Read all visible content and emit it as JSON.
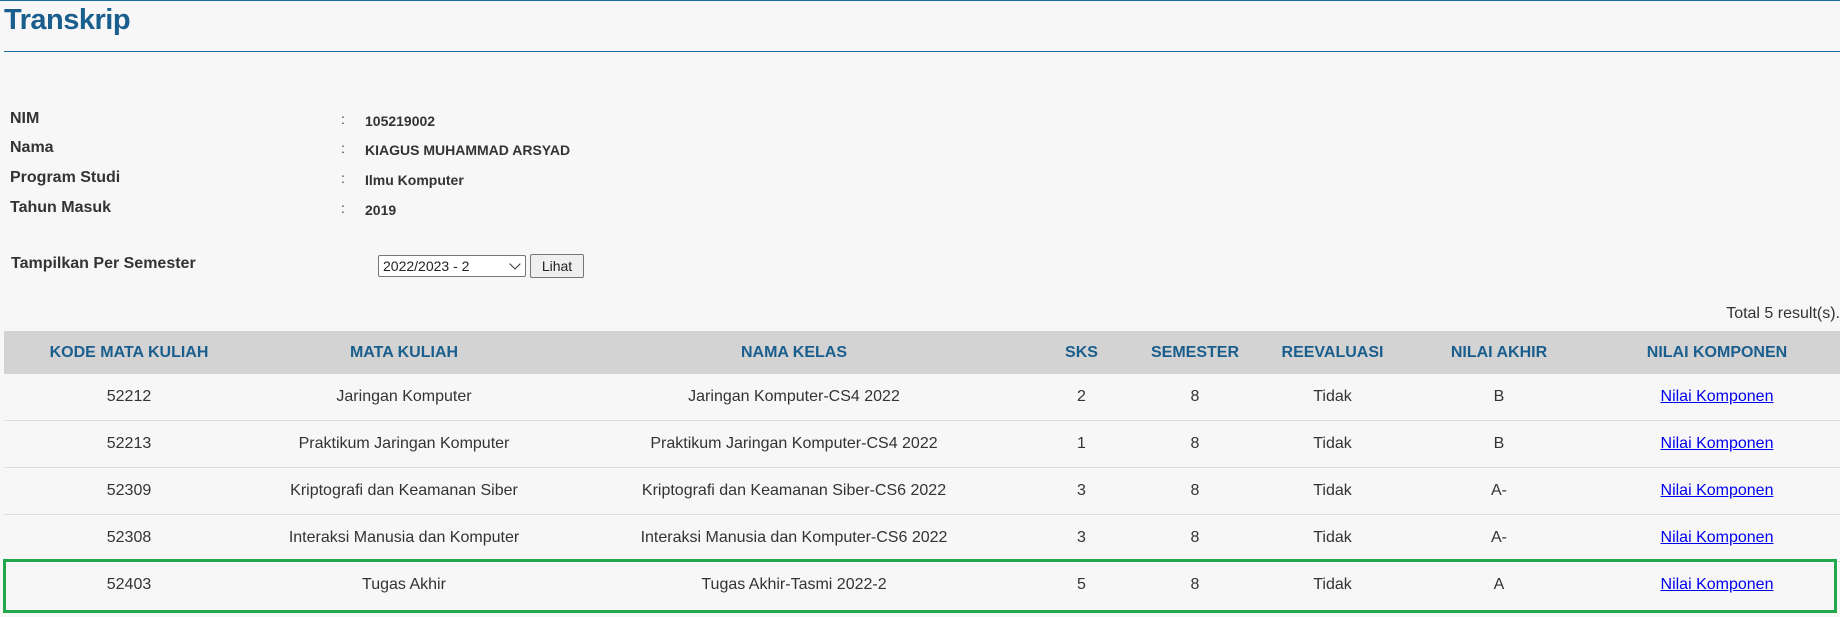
{
  "page": {
    "title": "Transkrip"
  },
  "student": {
    "separator": ":",
    "fields": [
      {
        "label": "NIM",
        "value": "105219002"
      },
      {
        "label": "Nama",
        "value": "KIAGUS MUHAMMAD ARSYAD"
      },
      {
        "label": "Program Studi",
        "value": "Ilmu Komputer"
      },
      {
        "label": "Tahun Masuk",
        "value": "2019"
      }
    ]
  },
  "filter": {
    "label": "Tampilkan Per Semester",
    "selected": "2022/2023 - 2",
    "button_label": "Lihat"
  },
  "results": {
    "summary": "Total 5 result(s)."
  },
  "table": {
    "headers": [
      "KODE MATA KULIAH",
      "MATA KULIAH",
      "NAMA KELAS",
      "SKS",
      "SEMESTER",
      "REEVALUASI",
      "NILAI AKHIR",
      "NILAI KOMPONEN"
    ],
    "rows": [
      {
        "kode": "52212",
        "mata_kuliah": "Jaringan Komputer",
        "nama_kelas": "Jaringan Komputer-CS4 2022",
        "sks": "2",
        "semester": "8",
        "reevaluasi": "Tidak",
        "nilai_akhir": "B",
        "nilai_komponen": "Nilai Komponen"
      },
      {
        "kode": "52213",
        "mata_kuliah": "Praktikum Jaringan Komputer",
        "nama_kelas": "Praktikum Jaringan Komputer-CS4 2022",
        "sks": "1",
        "semester": "8",
        "reevaluasi": "Tidak",
        "nilai_akhir": "B",
        "nilai_komponen": "Nilai Komponen"
      },
      {
        "kode": "52309",
        "mata_kuliah": "Kriptografi dan Keamanan Siber",
        "nama_kelas": "Kriptografi dan Keamanan Siber-CS6 2022",
        "sks": "3",
        "semester": "8",
        "reevaluasi": "Tidak",
        "nilai_akhir": "A-",
        "nilai_komponen": "Nilai Komponen"
      },
      {
        "kode": "52308",
        "mata_kuliah": "Interaksi Manusia dan Komputer",
        "nama_kelas": "Interaksi Manusia dan Komputer-CS6 2022",
        "sks": "3",
        "semester": "8",
        "reevaluasi": "Tidak",
        "nilai_akhir": "A-",
        "nilai_komponen": "Nilai Komponen"
      },
      {
        "kode": "52403",
        "mata_kuliah": "Tugas Akhir",
        "nama_kelas": "Tugas Akhir-Tasmi 2022-2",
        "sks": "5",
        "semester": "8",
        "reevaluasi": "Tidak",
        "nilai_akhir": "A",
        "nilai_komponen": "Nilai Komponen"
      }
    ]
  },
  "colors": {
    "title": "#1a5e8e",
    "header_bg": "#d3d3d3",
    "link": "#0000ee",
    "highlight": "#22a84a"
  }
}
